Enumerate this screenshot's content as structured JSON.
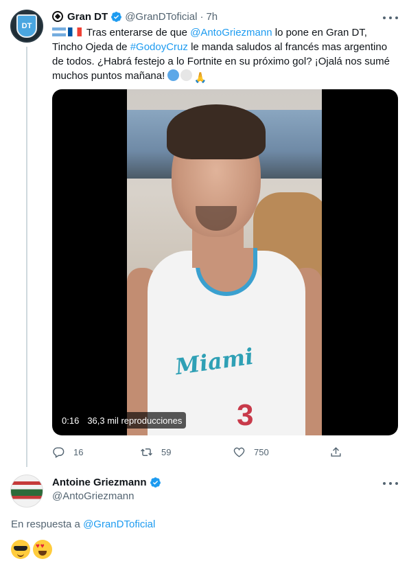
{
  "tweet": {
    "author_name": "Gran DT",
    "author_handle": "@GranDToficial",
    "separator": "·",
    "time": "7h",
    "avatar_text": "DT",
    "text": {
      "p1": "Tras enterarse de que ",
      "mention": "@AntoGriezmann",
      "p2": " lo pone en Gran DT, Tincho Ojeda de ",
      "hashtag": "#GodoyCruz",
      "p3": " le manda saludos al francés mas argentino de todos. ¿Habrá festejo a lo Fortnite en su próximo gol? ¡Ojalá nos sumé muchos puntos mañana! ",
      "trailing_emoji": "🙏"
    },
    "video": {
      "time": "0:16",
      "views": "36,3 mil reproducciones",
      "jersey_text": "Miami",
      "jersey_number": "3"
    },
    "actions": {
      "replies": "16",
      "retweets": "59",
      "likes": "750"
    }
  },
  "reply": {
    "author_name": "Antoine Griezmann",
    "author_handle": "@AntoGriezmann",
    "in_reply_prefix": "En respuesta a",
    "in_reply_handle": "@GranDToficial"
  },
  "colors": {
    "link": "#1d9bf0",
    "verified": "#1d9bf0",
    "secondary_text": "#536471",
    "thread_line": "#cfd9de"
  }
}
